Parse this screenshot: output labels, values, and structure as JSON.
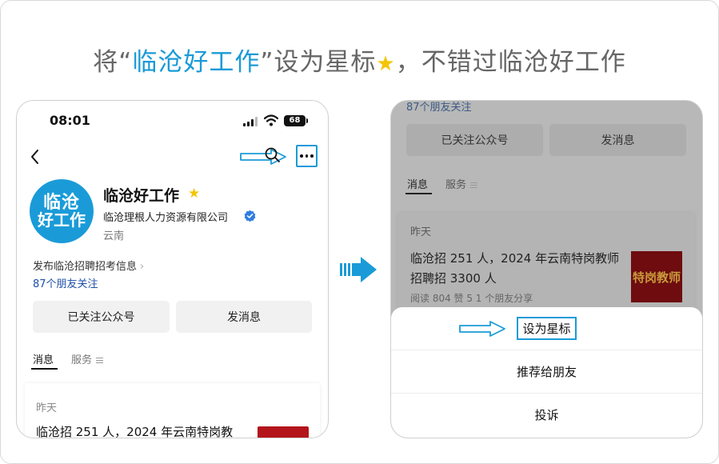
{
  "headline": {
    "prefix": "将“",
    "highlight": "临沧好工作",
    "suffix_before_star": "”设为星标",
    "suffix_after_star": "，不错过临沧好工作"
  },
  "phone_left": {
    "status_bar": {
      "time": "08:01",
      "battery": "68"
    },
    "account": {
      "avatar_line1": "临沧",
      "avatar_line2": "好工作",
      "name": "临沧好工作",
      "company": "临沧理根人力资源有限公司",
      "region": "云南"
    },
    "publish_info": "发布临沧招聘招考信息",
    "friends_follow": "87个朋友关注",
    "buttons": {
      "followed": "已关注公众号",
      "message": "发消息"
    },
    "tabs": [
      {
        "label": "消息"
      },
      {
        "label": "服务"
      }
    ],
    "feed": {
      "date": "昨天",
      "article_title_partial": "临沧招 251 人，2024 年云南特岗教"
    }
  },
  "phone_right": {
    "friends_follow": "87个朋友关注",
    "buttons": {
      "followed": "已关注公众号",
      "message": "发消息"
    },
    "tabs": [
      {
        "label": "消息"
      },
      {
        "label": "服务"
      }
    ],
    "feed": {
      "date": "昨天",
      "article_title": "临沧招 251 人，2024 年云南特岗教师招聘招 3300 人",
      "stats": "阅读 804  赞 5  1 个朋友分享",
      "thumbnail_text": "特岗教师"
    },
    "action_sheet": {
      "items": [
        "设为星标",
        "推荐给朋友",
        "投诉"
      ]
    }
  },
  "colors": {
    "accent": "#1a9bd8",
    "star": "#f5c400",
    "link": "#1d4fa8",
    "thumbnail_red": "#b3151b"
  },
  "icons": [
    "back-icon",
    "search-icon",
    "more-icon",
    "star-icon",
    "verified-icon",
    "chevron-right-icon",
    "menu-icon",
    "signal-icon",
    "wifi-icon",
    "battery-icon",
    "flow-arrow-icon",
    "pointer-arrow-icon"
  ]
}
